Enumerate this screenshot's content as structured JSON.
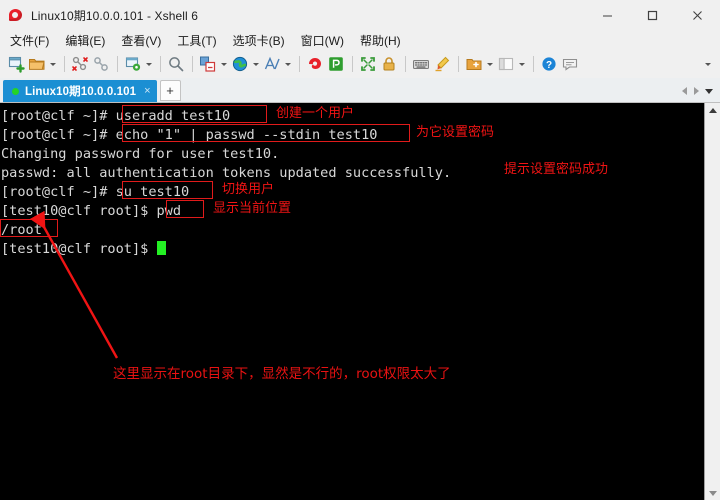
{
  "window": {
    "title": "Linux10期10.0.0.101 - Xshell 6",
    "app_icon": "xshell-logo-icon",
    "controls": {
      "minimize": "minimize-button",
      "maximize": "maximize-button",
      "close": "close-button"
    }
  },
  "menubar": {
    "items": [
      {
        "label": "文件(F)",
        "name": "menu-file"
      },
      {
        "label": "编辑(E)",
        "name": "menu-edit"
      },
      {
        "label": "查看(V)",
        "name": "menu-view"
      },
      {
        "label": "工具(T)",
        "name": "menu-tools"
      },
      {
        "label": "选项卡(B)",
        "name": "menu-tabs"
      },
      {
        "label": "窗口(W)",
        "name": "menu-window"
      },
      {
        "label": "帮助(H)",
        "name": "menu-help"
      }
    ]
  },
  "toolbar": {
    "icons": [
      "new-session-icon",
      "open-folder-icon",
      "separator",
      "disconnect-icon",
      "connect-link-icon",
      "separator",
      "session-properties-icon",
      "separator",
      "find-icon",
      "separator",
      "file-transfer-icon",
      "globe-icon",
      "font-icon",
      "separator",
      "xshell-icon",
      "xftp-icon",
      "separator",
      "fullscreen-icon",
      "lock-icon",
      "separator",
      "keyboard-icon",
      "highlight-icon",
      "separator",
      "new-folder-icon",
      "layout-icon",
      "separator",
      "help-icon",
      "chat-icon"
    ],
    "overflow": "toolbar-overflow-caret"
  },
  "tabbar": {
    "tabs": [
      {
        "label": "Linux10期10.0.0.101",
        "status": "connected",
        "close": "×"
      }
    ],
    "add_label": "+",
    "nav_prev": "tab-prev-arrow",
    "nav_next": "tab-next-arrow",
    "nav_list": "tab-list-caret"
  },
  "terminal": {
    "lines": [
      {
        "prompt": "[root@clf ~]# ",
        "cmd": "useradd test10",
        "rest": ""
      },
      {
        "prompt": "[root@clf ~]# ",
        "cmd": "echo \"1\" | passwd --stdin test10",
        "rest": ""
      },
      {
        "prompt": "",
        "cmd": "",
        "rest": "Changing password for user test10."
      },
      {
        "prompt": "",
        "cmd": "",
        "rest": "passwd: all authentication tokens updated successfully."
      },
      {
        "prompt": "[root@clf ~]# ",
        "cmd": "su test10",
        "rest": ""
      },
      {
        "prompt": "[test10@clf root]$ ",
        "cmd": "pwd",
        "rest": ""
      },
      {
        "prompt": "",
        "cmd": "",
        "rest": "/root"
      },
      {
        "prompt": "[test10@clf root]$ ",
        "cmd": "",
        "rest": ""
      }
    ],
    "cursor": "block-cursor",
    "annotations": [
      {
        "text": "创建一个用户",
        "name": "annotation-create-user"
      },
      {
        "text": "为它设置密码",
        "name": "annotation-set-password"
      },
      {
        "text": "提示设置密码成功",
        "name": "annotation-password-success"
      },
      {
        "text": "切换用户",
        "name": "annotation-switch-user"
      },
      {
        "text": "显示当前位置",
        "name": "annotation-show-location"
      },
      {
        "text": "这里显示在root目录下，显然是不行的，root权限太大了",
        "name": "annotation-root-warning"
      }
    ],
    "scrollbar": {
      "up": "scroll-up-arrow",
      "down": "scroll-down-arrow"
    }
  },
  "colors": {
    "annotation_red": "#f01414",
    "tab_blue": "#1b8fd3",
    "cursor_green": "#24f024",
    "terminal_bg": "#000000",
    "terminal_fg": "#d8d8d8"
  }
}
